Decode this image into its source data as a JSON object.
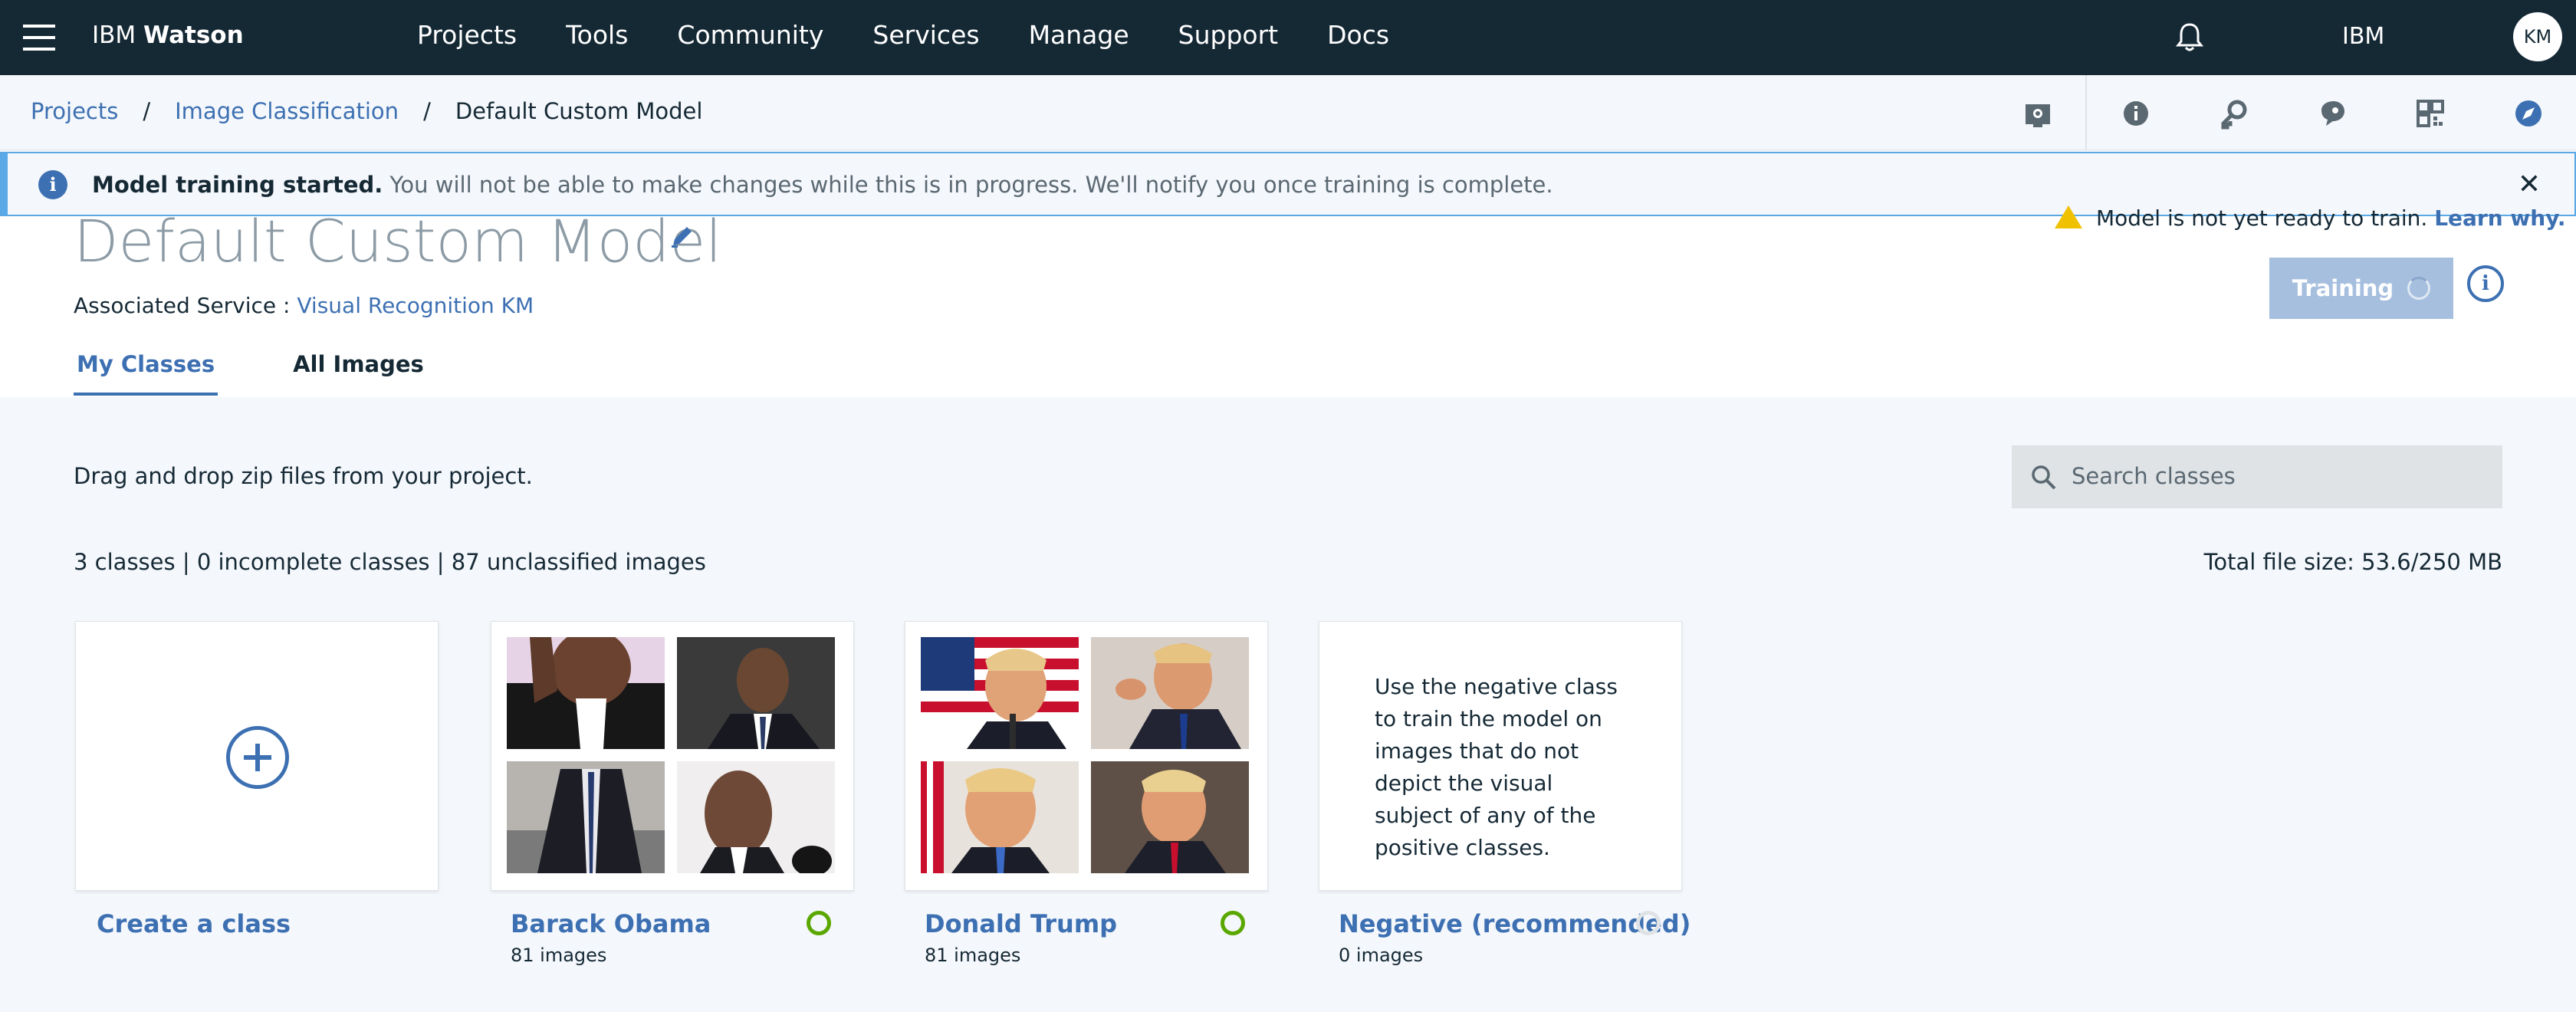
{
  "topbar": {
    "brand_prefix": "IBM",
    "brand_bold": "Watson",
    "nav": [
      "Projects",
      "Tools",
      "Community",
      "Services",
      "Manage",
      "Support",
      "Docs"
    ],
    "account": "IBM",
    "avatar_initials": "KM",
    "bg_color": "#152935"
  },
  "breadcrumb": {
    "items": [
      "Projects",
      "Image Classification"
    ],
    "current": "Default Custom Model",
    "separator": "/"
  },
  "tools": [
    "asset-icon",
    "info-icon",
    "key-icon",
    "chat-icon",
    "apps-icon",
    "compass-icon"
  ],
  "notification": {
    "title": "Model training started.",
    "message": " You will not be able to make changes while this is in progress. We'll notify you once training is complete.",
    "close": "✕"
  },
  "header": {
    "title": "Default Custom Model",
    "associated_label": "Associated Service : ",
    "associated_service": "Visual Recognition KM",
    "warning_text": "Model is not yet ready to train. ",
    "warning_link": "Learn why.",
    "train_button": "Training",
    "info": "i"
  },
  "tabs": [
    "My Classes",
    "All Images"
  ],
  "content": {
    "drag_hint": "Drag and drop zip files from your project.",
    "search_placeholder": "Search classes",
    "stats": "3 classes | 0 incomplete classes | 87 unclassified images",
    "filesize": "Total file size: 53.6/250 MB"
  },
  "cards": [
    {
      "label": "Create a class",
      "count": ""
    },
    {
      "label": "Barack Obama",
      "count": "81 images",
      "status": "complete"
    },
    {
      "label": "Donald Trump",
      "count": "81 images",
      "status": "complete"
    },
    {
      "label": "Negative (recommended)",
      "count": "0 images",
      "status": "empty",
      "description": "Use the negative class to train the model on images that do not depict the visual subject of any of the positive classes."
    }
  ],
  "colors": {
    "accent": "#3d70b2",
    "success": "#5aa700",
    "notice_border": "#5aa9e6",
    "warning": "#efc100"
  }
}
